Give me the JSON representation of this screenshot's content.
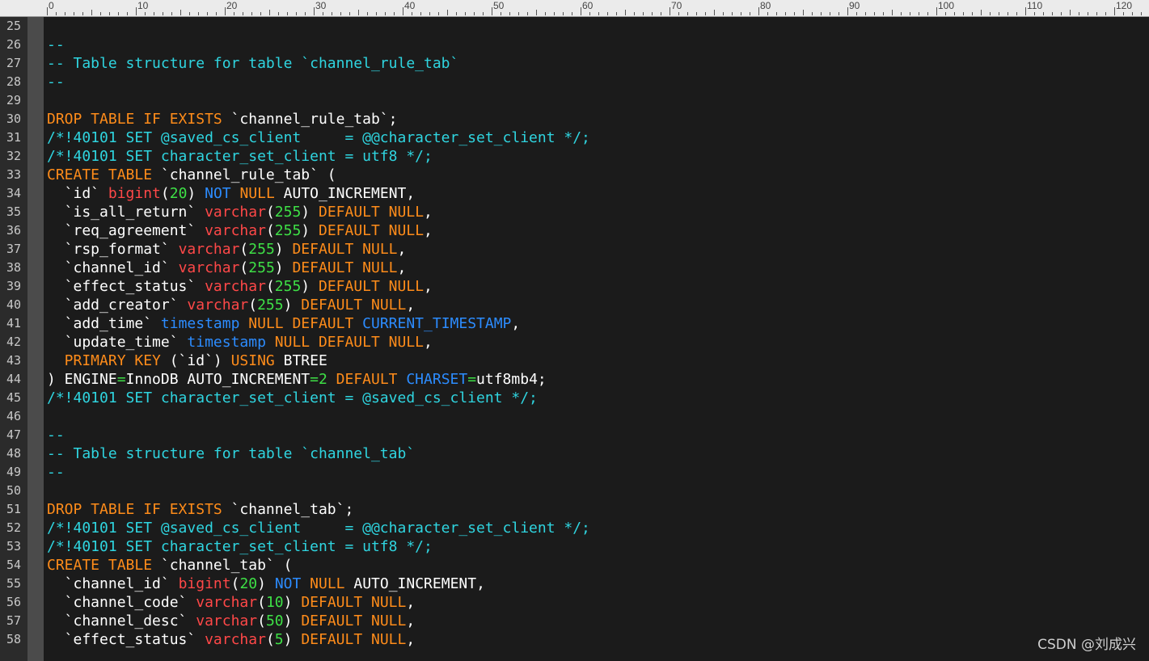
{
  "ruler": {
    "labels": [
      "0",
      "10",
      "20",
      "30",
      "40",
      "50",
      "60",
      "70",
      "80",
      "90",
      "100",
      "110",
      "120"
    ]
  },
  "colors": {
    "background": "#1b1b1b",
    "comment": "#2fd5e0",
    "keyword": "#ff8c1a",
    "type": "#ff4848",
    "number": "#3ee046",
    "blue_keyword": "#2c8cff",
    "identifier": "#ffffff"
  },
  "lines": [
    {
      "n": "25",
      "tokens": []
    },
    {
      "n": "26",
      "tokens": [
        {
          "t": "--",
          "c": "comment"
        }
      ]
    },
    {
      "n": "27",
      "tokens": [
        {
          "t": "-- Table structure for table `channel_rule_tab`",
          "c": "comment"
        }
      ]
    },
    {
      "n": "28",
      "tokens": [
        {
          "t": "--",
          "c": "comment"
        }
      ]
    },
    {
      "n": "29",
      "tokens": []
    },
    {
      "n": "30",
      "tokens": [
        {
          "t": "DROP TABLE IF EXISTS ",
          "c": "kw"
        },
        {
          "t": "`channel_rule_tab`;",
          "c": "id"
        }
      ]
    },
    {
      "n": "31",
      "tokens": [
        {
          "t": "/*!40101 SET @saved_cs_client     = @@character_set_client */;",
          "c": "comment"
        }
      ]
    },
    {
      "n": "32",
      "tokens": [
        {
          "t": "/*!40101 SET character_set_client = utf8 */;",
          "c": "comment"
        }
      ]
    },
    {
      "n": "33",
      "tokens": [
        {
          "t": "CREATE TABLE ",
          "c": "kw"
        },
        {
          "t": "`channel_rule_tab` (",
          "c": "id"
        }
      ]
    },
    {
      "n": "34",
      "tokens": [
        {
          "t": "  `id` ",
          "c": "id"
        },
        {
          "t": "bigint",
          "c": "type"
        },
        {
          "t": "(",
          "c": "id"
        },
        {
          "t": "20",
          "c": "num"
        },
        {
          "t": ") ",
          "c": "id"
        },
        {
          "t": "NOT ",
          "c": "blue"
        },
        {
          "t": "NULL ",
          "c": "kw"
        },
        {
          "t": "AUTO_INCREMENT,",
          "c": "id"
        }
      ]
    },
    {
      "n": "35",
      "tokens": [
        {
          "t": "  `is_all_return` ",
          "c": "id"
        },
        {
          "t": "varchar",
          "c": "type"
        },
        {
          "t": "(",
          "c": "id"
        },
        {
          "t": "255",
          "c": "num"
        },
        {
          "t": ") ",
          "c": "id"
        },
        {
          "t": "DEFAULT NULL",
          "c": "kw"
        },
        {
          "t": ",",
          "c": "id"
        }
      ]
    },
    {
      "n": "36",
      "tokens": [
        {
          "t": "  `req_agreement` ",
          "c": "id"
        },
        {
          "t": "varchar",
          "c": "type"
        },
        {
          "t": "(",
          "c": "id"
        },
        {
          "t": "255",
          "c": "num"
        },
        {
          "t": ") ",
          "c": "id"
        },
        {
          "t": "DEFAULT NULL",
          "c": "kw"
        },
        {
          "t": ",",
          "c": "id"
        }
      ]
    },
    {
      "n": "37",
      "tokens": [
        {
          "t": "  `rsp_format` ",
          "c": "id"
        },
        {
          "t": "varchar",
          "c": "type"
        },
        {
          "t": "(",
          "c": "id"
        },
        {
          "t": "255",
          "c": "num"
        },
        {
          "t": ") ",
          "c": "id"
        },
        {
          "t": "DEFAULT NULL",
          "c": "kw"
        },
        {
          "t": ",",
          "c": "id"
        }
      ]
    },
    {
      "n": "38",
      "tokens": [
        {
          "t": "  `channel_id` ",
          "c": "id"
        },
        {
          "t": "varchar",
          "c": "type"
        },
        {
          "t": "(",
          "c": "id"
        },
        {
          "t": "255",
          "c": "num"
        },
        {
          "t": ") ",
          "c": "id"
        },
        {
          "t": "DEFAULT NULL",
          "c": "kw"
        },
        {
          "t": ",",
          "c": "id"
        }
      ]
    },
    {
      "n": "39",
      "tokens": [
        {
          "t": "  `effect_status` ",
          "c": "id"
        },
        {
          "t": "varchar",
          "c": "type"
        },
        {
          "t": "(",
          "c": "id"
        },
        {
          "t": "255",
          "c": "num"
        },
        {
          "t": ") ",
          "c": "id"
        },
        {
          "t": "DEFAULT NULL",
          "c": "kw"
        },
        {
          "t": ",",
          "c": "id"
        }
      ]
    },
    {
      "n": "40",
      "tokens": [
        {
          "t": "  `add_creator` ",
          "c": "id"
        },
        {
          "t": "varchar",
          "c": "type"
        },
        {
          "t": "(",
          "c": "id"
        },
        {
          "t": "255",
          "c": "num"
        },
        {
          "t": ") ",
          "c": "id"
        },
        {
          "t": "DEFAULT NULL",
          "c": "kw"
        },
        {
          "t": ",",
          "c": "id"
        }
      ]
    },
    {
      "n": "41",
      "tokens": [
        {
          "t": "  `add_time` ",
          "c": "id"
        },
        {
          "t": "timestamp ",
          "c": "blue"
        },
        {
          "t": "NULL DEFAULT ",
          "c": "kw"
        },
        {
          "t": "CURRENT_TIMESTAMP",
          "c": "blue"
        },
        {
          "t": ",",
          "c": "id"
        }
      ]
    },
    {
      "n": "42",
      "tokens": [
        {
          "t": "  `update_time` ",
          "c": "id"
        },
        {
          "t": "timestamp ",
          "c": "blue"
        },
        {
          "t": "NULL DEFAULT NULL",
          "c": "kw"
        },
        {
          "t": ",",
          "c": "id"
        }
      ]
    },
    {
      "n": "43",
      "tokens": [
        {
          "t": "  PRIMARY KEY ",
          "c": "kw"
        },
        {
          "t": "(`id`) ",
          "c": "id"
        },
        {
          "t": "USING ",
          "c": "kw"
        },
        {
          "t": "BTREE",
          "c": "id"
        }
      ]
    },
    {
      "n": "44",
      "tokens": [
        {
          "t": ") ENGINE",
          "c": "id"
        },
        {
          "t": "=",
          "c": "num"
        },
        {
          "t": "InnoDB AUTO_INCREMENT",
          "c": "id"
        },
        {
          "t": "=2 ",
          "c": "num"
        },
        {
          "t": "DEFAULT ",
          "c": "kw"
        },
        {
          "t": "CHARSET",
          "c": "blue"
        },
        {
          "t": "=",
          "c": "num"
        },
        {
          "t": "utf8mb4;",
          "c": "id"
        }
      ]
    },
    {
      "n": "45",
      "tokens": [
        {
          "t": "/*!40101 SET character_set_client = @saved_cs_client */;",
          "c": "comment"
        }
      ]
    },
    {
      "n": "46",
      "tokens": []
    },
    {
      "n": "47",
      "tokens": [
        {
          "t": "--",
          "c": "comment"
        }
      ]
    },
    {
      "n": "48",
      "tokens": [
        {
          "t": "-- Table structure for table `channel_tab`",
          "c": "comment"
        }
      ]
    },
    {
      "n": "49",
      "tokens": [
        {
          "t": "--",
          "c": "comment"
        }
      ]
    },
    {
      "n": "50",
      "tokens": []
    },
    {
      "n": "51",
      "tokens": [
        {
          "t": "DROP TABLE IF EXISTS ",
          "c": "kw"
        },
        {
          "t": "`channel_tab`;",
          "c": "id"
        }
      ]
    },
    {
      "n": "52",
      "tokens": [
        {
          "t": "/*!40101 SET @saved_cs_client     = @@character_set_client */;",
          "c": "comment"
        }
      ]
    },
    {
      "n": "53",
      "tokens": [
        {
          "t": "/*!40101 SET character_set_client = utf8 */;",
          "c": "comment"
        }
      ]
    },
    {
      "n": "54",
      "tokens": [
        {
          "t": "CREATE TABLE ",
          "c": "kw"
        },
        {
          "t": "`channel_tab` (",
          "c": "id"
        }
      ]
    },
    {
      "n": "55",
      "tokens": [
        {
          "t": "  `channel_id` ",
          "c": "id"
        },
        {
          "t": "bigint",
          "c": "type"
        },
        {
          "t": "(",
          "c": "id"
        },
        {
          "t": "20",
          "c": "num"
        },
        {
          "t": ") ",
          "c": "id"
        },
        {
          "t": "NOT ",
          "c": "blue"
        },
        {
          "t": "NULL ",
          "c": "kw"
        },
        {
          "t": "AUTO_INCREMENT,",
          "c": "id"
        }
      ]
    },
    {
      "n": "56",
      "tokens": [
        {
          "t": "  `channel_code` ",
          "c": "id"
        },
        {
          "t": "varchar",
          "c": "type"
        },
        {
          "t": "(",
          "c": "id"
        },
        {
          "t": "10",
          "c": "num"
        },
        {
          "t": ") ",
          "c": "id"
        },
        {
          "t": "DEFAULT NULL",
          "c": "kw"
        },
        {
          "t": ",",
          "c": "id"
        }
      ]
    },
    {
      "n": "57",
      "tokens": [
        {
          "t": "  `channel_desc` ",
          "c": "id"
        },
        {
          "t": "varchar",
          "c": "type"
        },
        {
          "t": "(",
          "c": "id"
        },
        {
          "t": "50",
          "c": "num"
        },
        {
          "t": ") ",
          "c": "id"
        },
        {
          "t": "DEFAULT NULL",
          "c": "kw"
        },
        {
          "t": ",",
          "c": "id"
        }
      ]
    },
    {
      "n": "58",
      "tokens": [
        {
          "t": "  `effect_status` ",
          "c": "id"
        },
        {
          "t": "varchar",
          "c": "type"
        },
        {
          "t": "(",
          "c": "id"
        },
        {
          "t": "5",
          "c": "num"
        },
        {
          "t": ") ",
          "c": "id"
        },
        {
          "t": "DEFAULT NULL",
          "c": "kw"
        },
        {
          "t": ",",
          "c": "id"
        }
      ]
    }
  ],
  "watermark": "CSDN @刘成兴"
}
